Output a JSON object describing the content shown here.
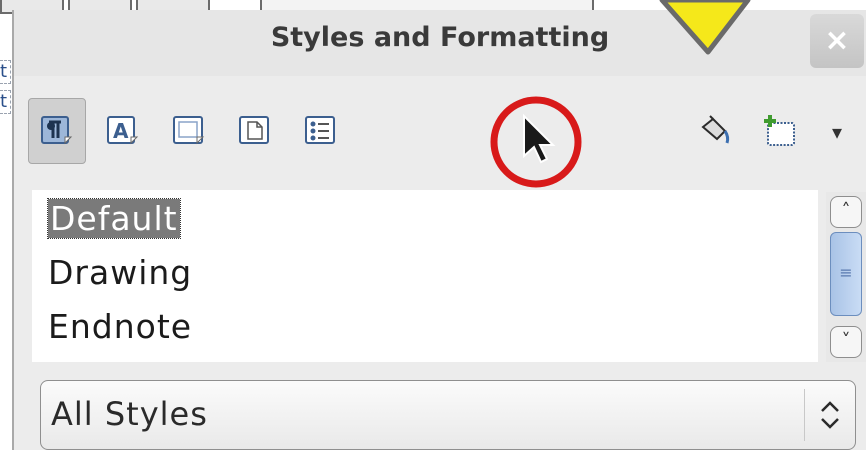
{
  "window": {
    "title": "Styles and Formatting",
    "close_label": "×"
  },
  "toolbar": {
    "buttons": [
      {
        "name": "paragraph-styles",
        "icon": "paragraph-style-icon",
        "active": true
      },
      {
        "name": "character-styles",
        "icon": "character-style-icon",
        "active": false
      },
      {
        "name": "frame-styles",
        "icon": "frame-style-icon",
        "active": false
      },
      {
        "name": "page-styles",
        "icon": "page-style-icon",
        "active": false
      },
      {
        "name": "list-styles",
        "icon": "list-style-icon",
        "active": false
      }
    ],
    "right_buttons": [
      {
        "name": "fill-format-mode",
        "icon": "paint-bucket-icon"
      },
      {
        "name": "new-style-from-selection",
        "icon": "new-style-icon"
      }
    ],
    "dropdown_glyph": "▾"
  },
  "styles_list": {
    "items": [
      "Default",
      "Drawing",
      "Endnote"
    ],
    "selected_index": 0
  },
  "scrollbar": {
    "up_glyph": "˄",
    "down_glyph": "˅",
    "thumb_glyph": "≡"
  },
  "filter": {
    "selected": "All Styles"
  },
  "colors": {
    "annotation_ring": "#d81a1a",
    "annotation_arrow": "#f5e81a",
    "selection": "#7a7a7a"
  }
}
